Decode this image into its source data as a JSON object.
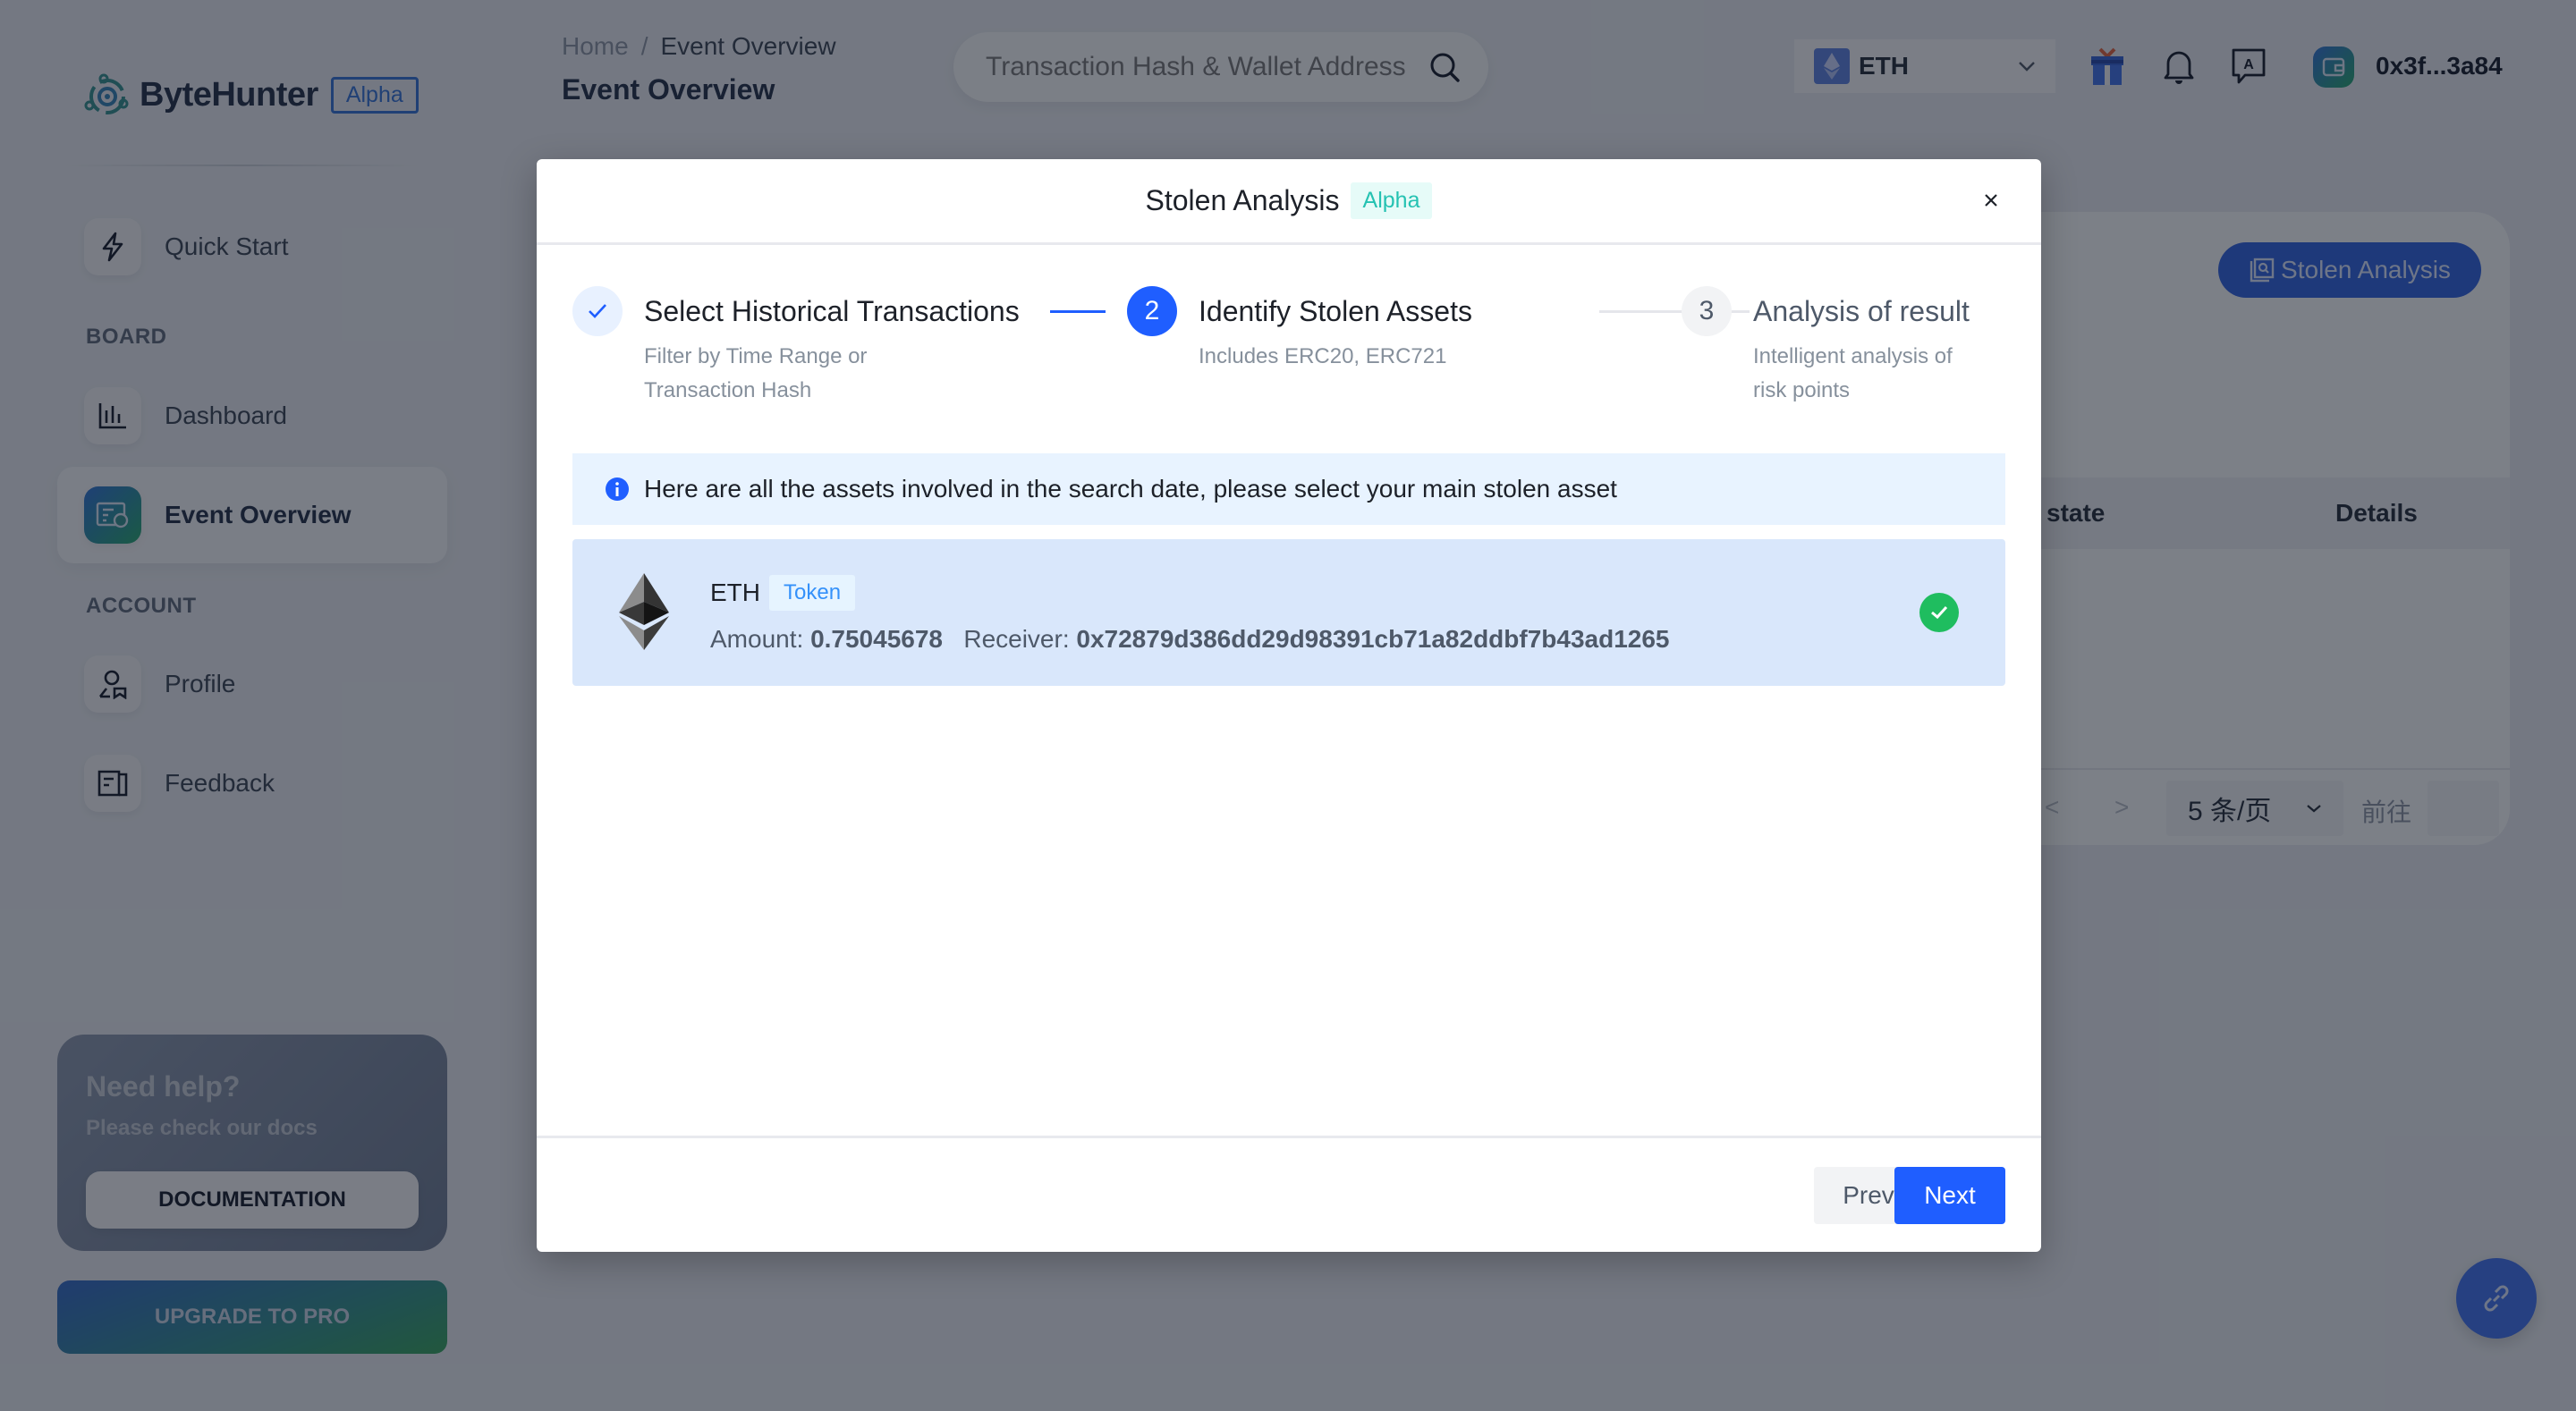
{
  "app": {
    "name": "ByteHunter",
    "badge": "Alpha"
  },
  "sidebar": {
    "items": [
      {
        "label": "Quick Start",
        "icon": "lightning-icon"
      },
      {
        "label": "Dashboard",
        "icon": "bar-chart-icon"
      },
      {
        "label": "Event Overview",
        "icon": "event-overview-icon",
        "active": true
      },
      {
        "label": "Profile",
        "icon": "user-profile-icon"
      },
      {
        "label": "Feedback",
        "icon": "feedback-icon"
      }
    ],
    "sections": {
      "board": "BOARD",
      "account": "ACCOUNT"
    },
    "help": {
      "title": "Need help?",
      "subtitle": "Please check our docs",
      "button": "DOCUMENTATION"
    },
    "upgrade": "UPGRADE TO PRO"
  },
  "header": {
    "breadcrumb": {
      "home": "Home",
      "separator": "/",
      "current": "Event Overview"
    },
    "page_title": "Event Overview",
    "search_placeholder": "Transaction Hash & Wallet Address",
    "chain": "ETH",
    "wallet_address": "0x3f...3a84"
  },
  "main": {
    "stolen_button": "Stolen Analysis",
    "table_headers": {
      "state": "state",
      "details": "Details"
    },
    "pager": {
      "prev": "<",
      "next": ">",
      "page_size": "5 条/页",
      "goto": "前往"
    }
  },
  "modal": {
    "title": "Stolen Analysis",
    "badge": "Alpha",
    "current_step": 2,
    "steps": [
      {
        "index": "1",
        "title": "Select Historical Transactions",
        "desc_line1": "Filter by Time Range or",
        "desc_line2": "Transaction Hash",
        "status": "done"
      },
      {
        "index": "2",
        "title": "Identify Stolen Assets",
        "desc_line1": "Includes ERC20, ERC721",
        "desc_line2": "",
        "status": "active"
      },
      {
        "index": "3",
        "title": "Analysis of result",
        "desc_line1": "Intelligent analysis of",
        "desc_line2": "risk points",
        "status": "wait"
      }
    ],
    "alert": "Here are all the assets involved in the search date, please select your main stolen asset",
    "assets": [
      {
        "name": "ETH",
        "tag": "Token",
        "amount_label": "Amount:",
        "amount": "0.75045678",
        "receiver_label": "Receiver:",
        "receiver": "0x72879d386dd29d98391cb71a82ddbf7b43ad1265",
        "selected": true
      }
    ],
    "buttons": {
      "prev": "Prev",
      "next": "Next"
    }
  },
  "colors": {
    "primary": "#1f5eff",
    "success": "#1fbd5f",
    "alpha_badge": "#25c2b2",
    "token_tag": "#3491fa"
  }
}
